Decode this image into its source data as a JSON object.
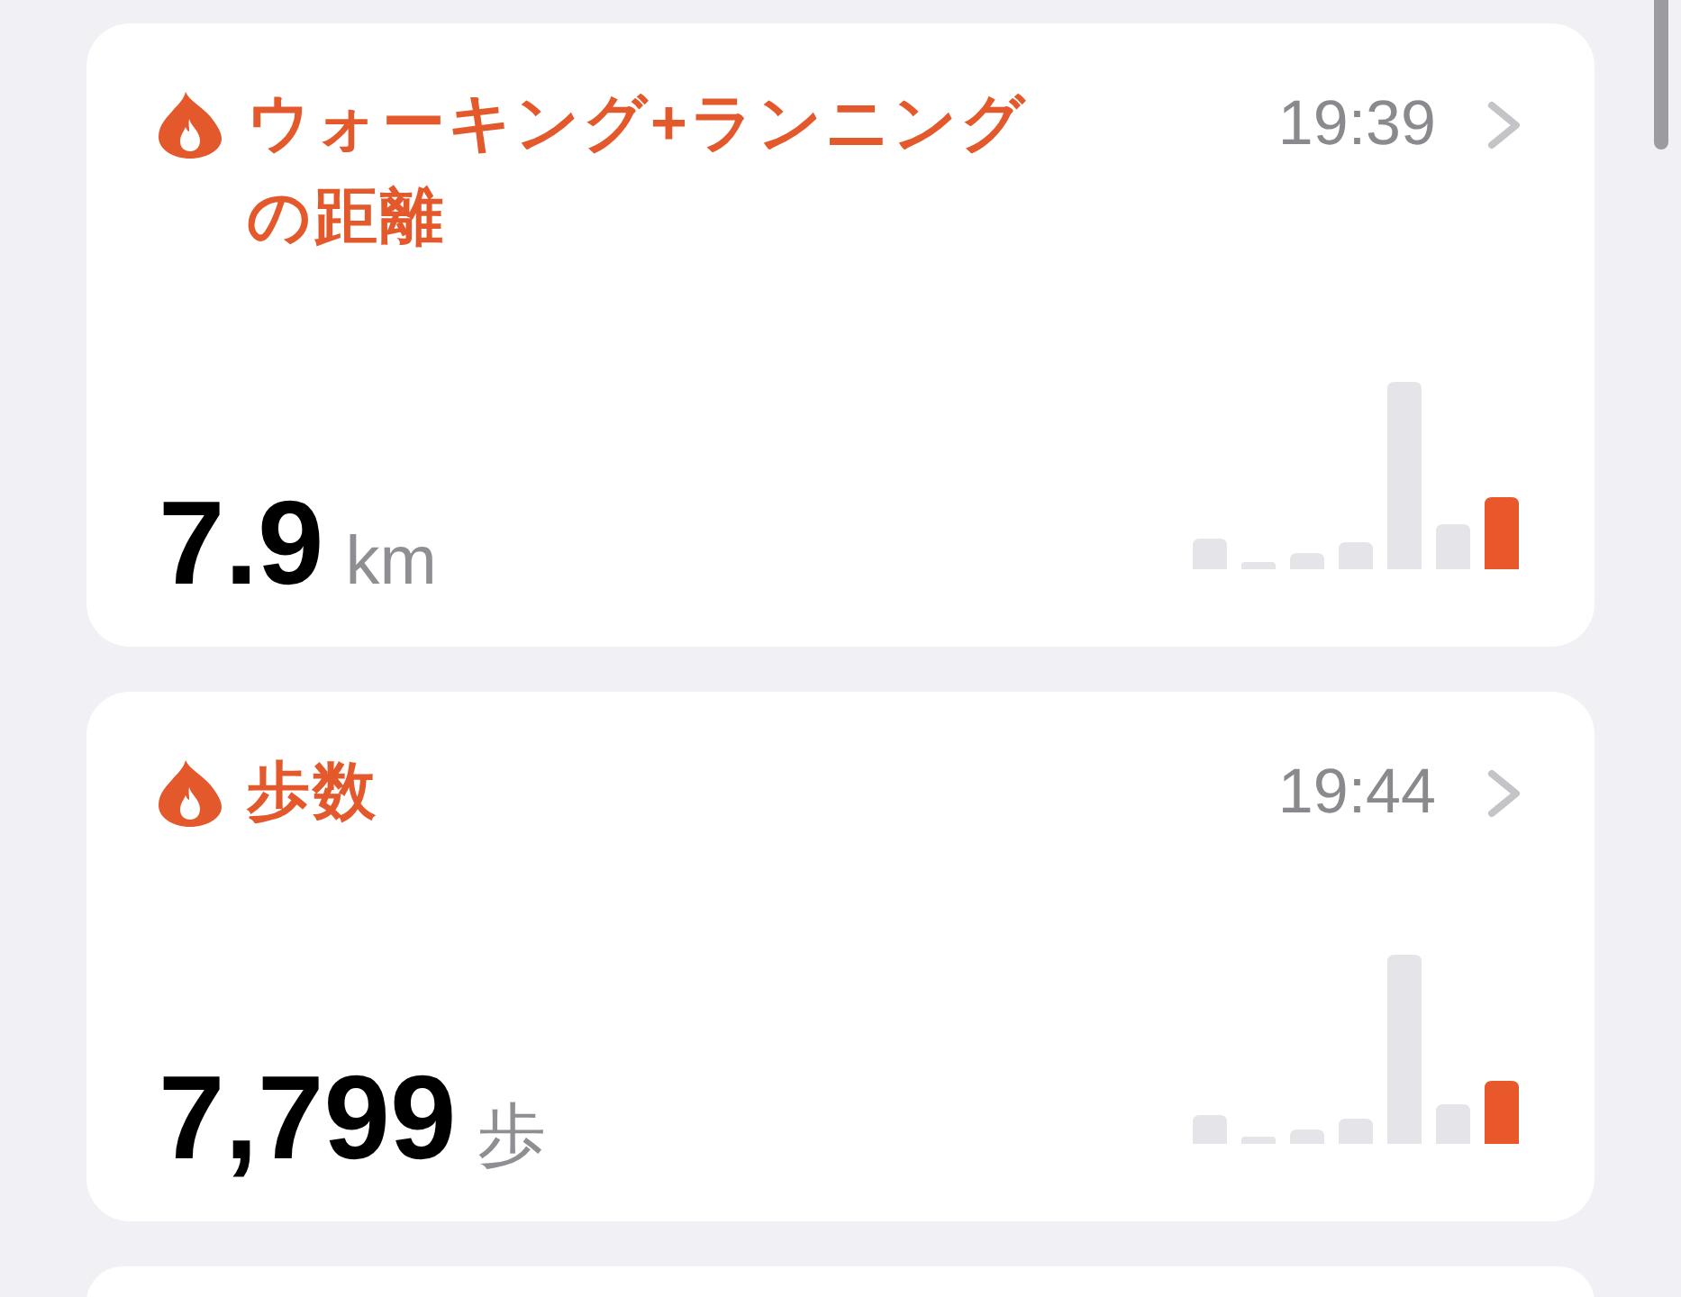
{
  "cards": [
    {
      "title": "ウォーキング+ランニングの距離",
      "time": "19:39",
      "value": "7.9",
      "unit": "km"
    },
    {
      "title": "歩数",
      "time": "19:44",
      "value": "7,799",
      "unit": "歩"
    }
  ]
}
